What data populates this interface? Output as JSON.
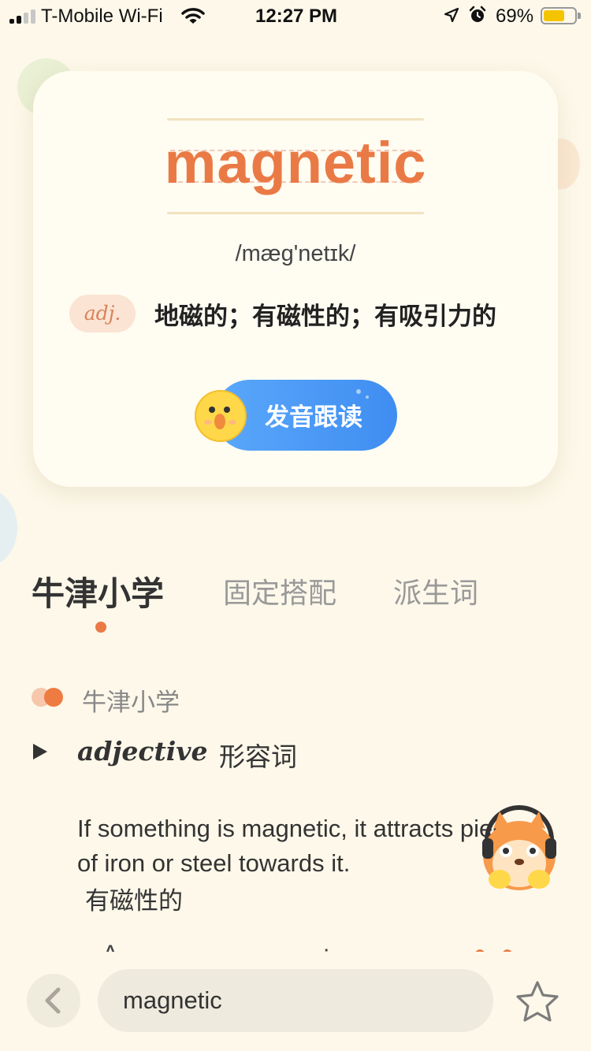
{
  "status_bar": {
    "carrier": "T-Mobile Wi-Fi",
    "time": "12:27 PM",
    "battery_percent": "69%",
    "battery_level": 0.69,
    "signal_bars_active": 2,
    "icons": [
      "wifi-icon",
      "location-arrow-icon",
      "alarm-icon",
      "battery-icon"
    ]
  },
  "word_card": {
    "word": "magnetic",
    "phonetic": "/mæg'netɪk/",
    "part_of_speech": "adj.",
    "definition": "地磁的；有磁性的；有吸引力的",
    "follow_read_label": "发音跟读",
    "follow_read_icon": "chick-face-icon"
  },
  "tabs": [
    {
      "label": "牛津小学",
      "active": true
    },
    {
      "label": "固定搭配",
      "active": false
    },
    {
      "label": "派生词",
      "active": false
    }
  ],
  "entry": {
    "source_title": "牛津小学",
    "pos_full": "adjective",
    "pos_cn": "形容词",
    "definition_en": "If something is magnetic, it attracts pieces of iron or steel towards it.",
    "definition_cn": "有磁性的"
  },
  "bottom_bar": {
    "back_icon": "chevron-left-icon",
    "search_value": "magnetic",
    "favorite_icon": "star-outline-icon"
  },
  "colors": {
    "background": "#fdf8ea",
    "accent_orange": "#ea7a45",
    "button_blue": "#4a97f5",
    "badge_bg": "#fbe4d4"
  }
}
